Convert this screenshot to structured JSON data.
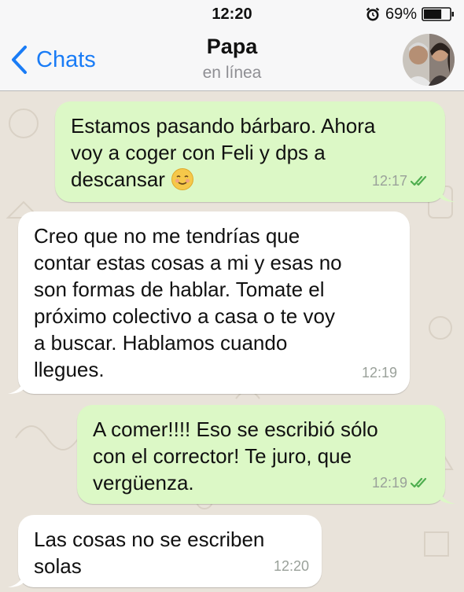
{
  "status_bar": {
    "time": "12:20",
    "battery_percent": "69%",
    "battery_level": 0.69,
    "icons": [
      "alarm-icon",
      "battery-icon"
    ]
  },
  "nav": {
    "back_label": "Chats",
    "contact_name": "Papa",
    "contact_status": "en línea"
  },
  "colors": {
    "accent": "#1a7cf6",
    "outgoing_bubble": "#dcf8c6",
    "incoming_bubble": "#ffffff",
    "read_check": "#4fae4f",
    "chat_background": "#e9e3da"
  },
  "messages": [
    {
      "direction": "outgoing",
      "text": "Estamos pasando bárbaro. Ahora\nvoy a coger con Feli y dps a\ndescansar",
      "emoji": "smiling-face-icon",
      "time": "12:17",
      "status": "read"
    },
    {
      "direction": "incoming",
      "text": "Creo que no me tendrías que\ncontar estas cosas a mi y esas no\nson formas de hablar. Tomate el\npróximo colectivo a casa o te voy\na buscar. Hablamos cuando\nllegues.",
      "time": "12:19"
    },
    {
      "direction": "outgoing",
      "text": "A comer!!!! Eso se escribió sólo\ncon el corrector! Te juro, que\nvergüenza.",
      "time": "12:19",
      "status": "read"
    },
    {
      "direction": "incoming",
      "text": "Las cosas no se escriben\nsolas",
      "time": "12:20"
    }
  ]
}
